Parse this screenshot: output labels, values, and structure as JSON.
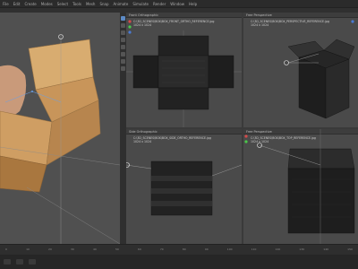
{
  "menubar": {
    "items": [
      "File",
      "Edit",
      "Create",
      "Modes",
      "Select",
      "Tools",
      "Mesh",
      "Snap",
      "Animate",
      "Simulate",
      "Render",
      "Window",
      "Help"
    ]
  },
  "viewports": {
    "top_left": {
      "title": "Front Orthographic",
      "info_line_1": "C:\\3D_SCENES\\BOX\\BOX_FRONT_ORTHO_REFERENCE.jpg",
      "info_line_2": "1024 x 1024"
    },
    "top_right": {
      "title": "Free Perspective",
      "info_line_1": "C:\\3D_SCENES\\BOX\\BOX_PERSPECTIVE_REFERENCE.jpg",
      "info_line_2": "1024 x 1024"
    },
    "bottom_left": {
      "title": "Side Orthographic",
      "info_line_1": "C:\\3D_SCENES\\BOX\\BOX_SIDE_ORTHO_REFERENCE.jpg",
      "info_line_2": "1024 x 1024"
    },
    "bottom_right": {
      "title": "Free Perspective",
      "info_line_1": "C:\\3D_SCENES\\BOX\\BOX_TOP_REFERENCE.jpg",
      "info_line_2": "1024 x 1024"
    }
  },
  "timeline": {
    "ticks": [
      "0",
      "10",
      "20",
      "30",
      "40",
      "50",
      "60",
      "70",
      "80",
      "90",
      "100",
      "110",
      "120",
      "130",
      "140",
      "150"
    ]
  },
  "colors": {
    "accent": "#5c8ac4",
    "viewport_bg": "#4a4a4a",
    "box_wood": "#d3a56b",
    "axis_x": "#d34a4a",
    "axis_y": "#4ac84a",
    "axis_z": "#4a7ad3"
  }
}
